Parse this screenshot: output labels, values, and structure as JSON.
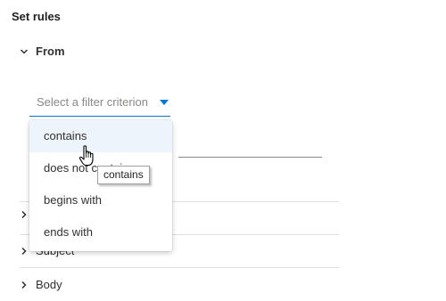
{
  "header": {
    "title": "Set rules"
  },
  "sections": {
    "from": {
      "label": "From"
    },
    "subject": {
      "label": "Subject"
    },
    "body": {
      "label": "Body"
    }
  },
  "filter_select": {
    "placeholder": "Select a filter criterion",
    "options": [
      "contains",
      "does not contain",
      "begins with",
      "ends with"
    ],
    "highlighted_index": 0
  },
  "tooltip": {
    "text": "contains"
  },
  "colors": {
    "accent": "#0078d4",
    "hover_bg": "#eef4fb",
    "divider": "#e1dfdd",
    "text": "#323130"
  },
  "icons": {
    "expanded": "chevron-down-icon",
    "collapsed": "chevron-right-icon",
    "dropdown": "caret-down-icon",
    "cursor": "hand-pointer-icon"
  }
}
